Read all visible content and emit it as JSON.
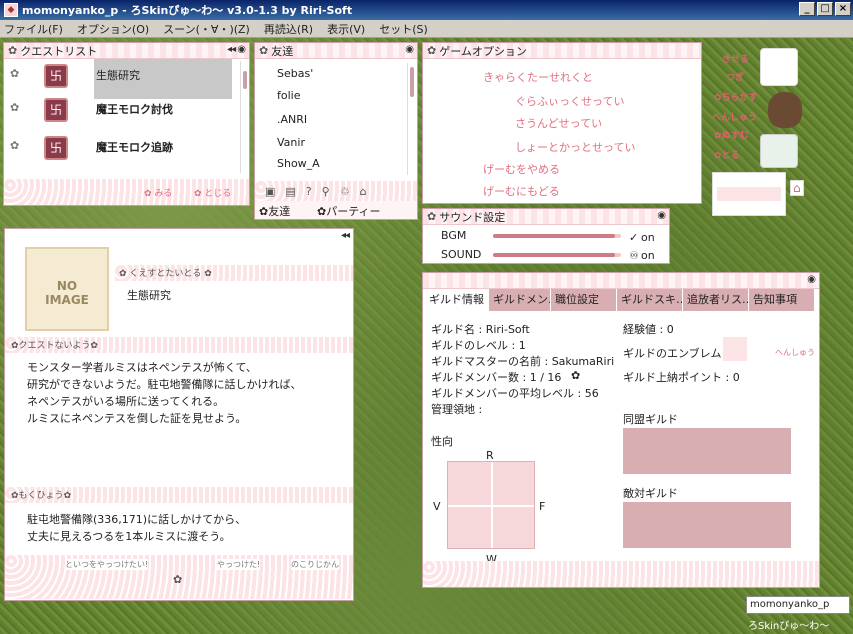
{
  "titlebar": {
    "title": "momonyanko_p - ろSkinぴゅ〜わ〜 v3.0-1.3 by Riri-Soft",
    "btn_min": "_",
    "btn_max": "□",
    "btn_close": "×"
  },
  "menu": [
    "ファイル(F)",
    "オプション(O)",
    "スーン(・∀・)(Z)",
    "再読込(R)",
    "表示(V)",
    "セット(S)"
  ],
  "questlist": {
    "title": "クエストリスト",
    "items": [
      "生態研究",
      "魔王モロク討伐",
      "魔王モロク追跡"
    ],
    "footer_view": "みる",
    "footer_close": "とじる"
  },
  "friends": {
    "title": "友達",
    "items": [
      "Sebas'",
      "folie",
      ".ANRI",
      "Vanir",
      "Show_A"
    ],
    "tab_friends": "友達",
    "tab_party": "パーティー"
  },
  "gameoptions": {
    "title": "ゲームオプション",
    "items": [
      "きゃらくたーせれくと",
      "ぐらふぃっくせってい",
      "さうんどせってい",
      "しょーとかっとせってい",
      "げーむをやめる",
      "げーむにもどる"
    ]
  },
  "sound": {
    "title": "サウンド設定",
    "bgm_label": "BGM",
    "bgm_state": "on",
    "bgm_level": 0.95,
    "sound_label": "SOUND",
    "sound_state": "on",
    "sound_level": 0.95
  },
  "side": {
    "items": [
      "きせる",
      "つぎ",
      "ちらかす",
      "へんしゅう",
      "ぬすむ",
      "とる"
    ]
  },
  "quest_detail": {
    "noimage": "NO IMAGE",
    "title_label": "くえすとたいとる",
    "title": "生態研究",
    "content_label": "クエストないよう",
    "content": [
      "モンスター学者ルミスはネペンテスが怖くて、",
      "研究ができないようだ。駐屯地警備隊に話しかければ、",
      "ネペンテスがいる場所に送ってくれる。",
      "ルミスにネペンテスを倒した証を見せよう。"
    ],
    "goal_label": "もくひょう",
    "goal": [
      "駐屯地警備隊(336,171)に話しかけてから、",
      "丈夫に見えるつるを1本ルミスに渡そう。"
    ],
    "footer": [
      "といつをやっつけたい!",
      "やっつけた!",
      "のこりじかん"
    ]
  },
  "guild": {
    "tabs": [
      "ギルド情報",
      "ギルドメン…",
      "職位設定",
      "ギルドスキ…",
      "追放者リス…",
      "告知事項"
    ],
    "name": "ギルド名 : Riri-Soft",
    "level": "ギルドのレベル : 1",
    "master": "ギルドマスターの名前 : SakumaRiri",
    "members": "ギルドメンバー数 : 1 / 16",
    "avg_level": "ギルドメンバーの平均レベル : 56",
    "territory": "管理領地 :",
    "exp": "経験値 : 0",
    "emblem": "ギルドのエンブレム",
    "emblem_edit": "へんしゅう",
    "tax": "ギルド上納ポイント : 0",
    "tendency": "性向",
    "axis_r": "R",
    "axis_v": "V",
    "axis_f": "F",
    "axis_w": "W",
    "allied": "同盟ギルド",
    "hostile": "敵対ギルド"
  },
  "taskbar": {
    "user": "momonyanko_p",
    "app": "ろSkinぴゅ〜わ〜"
  }
}
